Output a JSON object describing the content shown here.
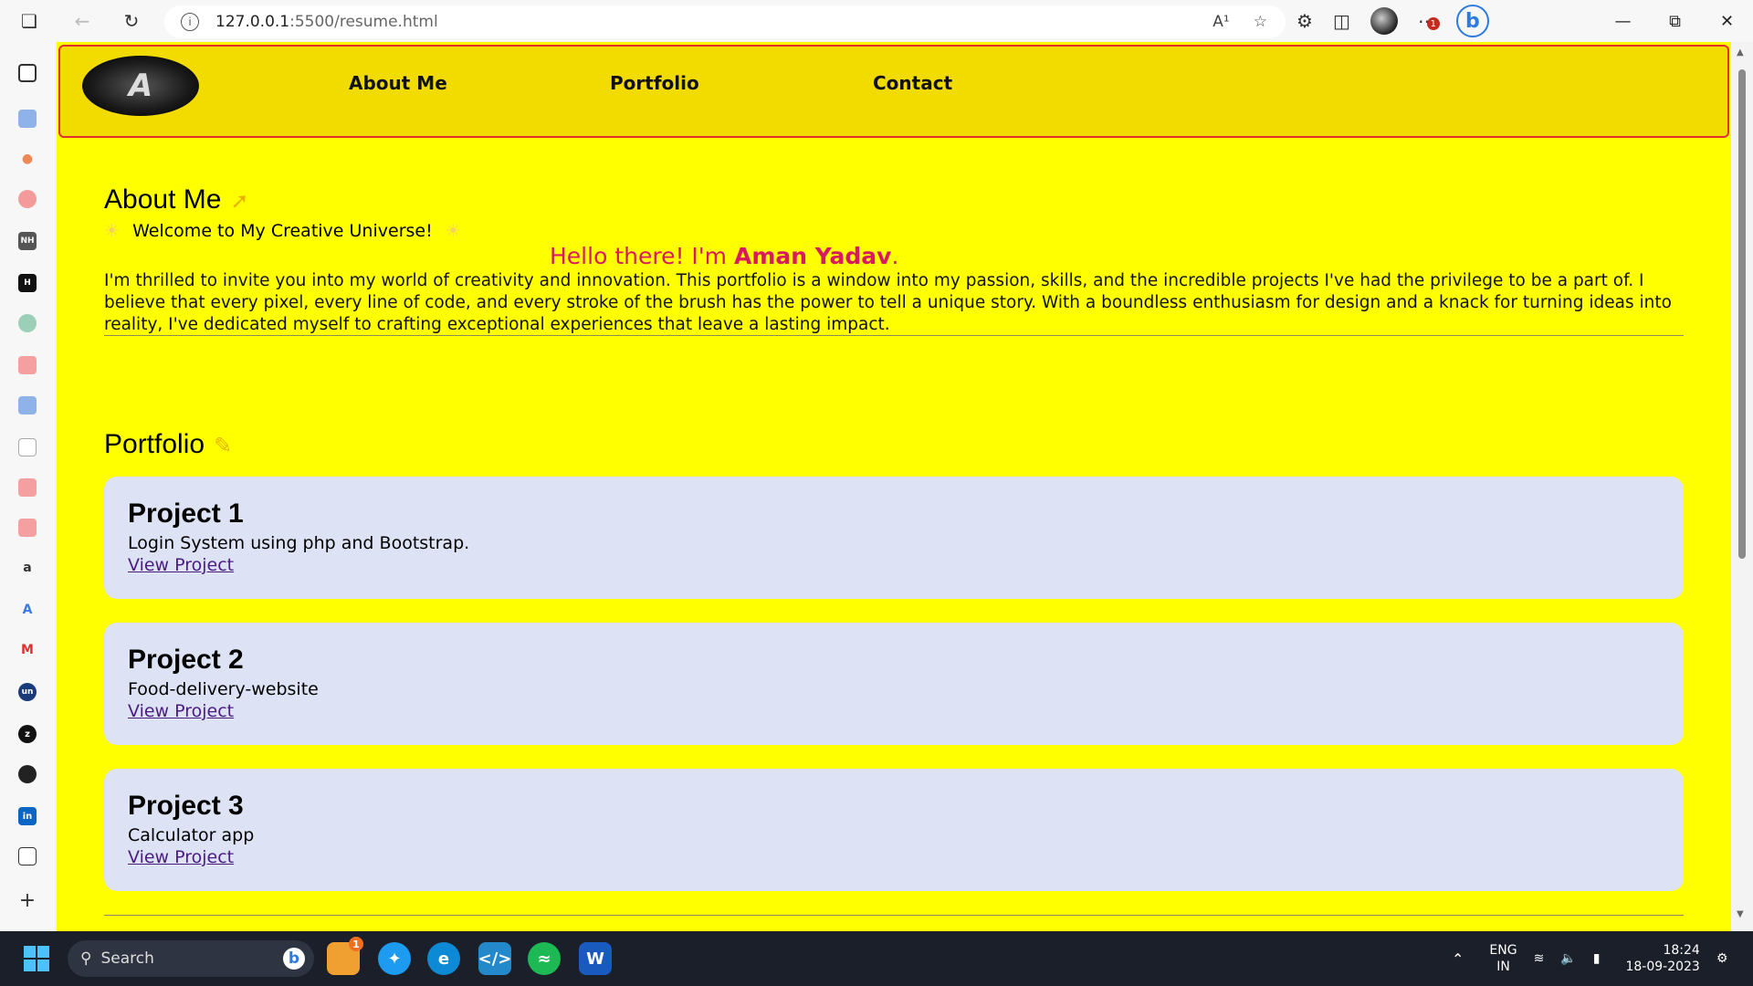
{
  "browser": {
    "url_host": "127.0.0.1",
    "url_path": ":5500/resume.html",
    "read_aloud": "A¹",
    "notif_count": "1"
  },
  "nav": {
    "logo_letter": "A",
    "links": [
      "About Me",
      "Portfolio",
      "Contact"
    ]
  },
  "about": {
    "title": "About Me",
    "welcome": "Welcome to My Creative Universe!",
    "hello_prefix": "Hello there! I'm ",
    "hello_name": "Aman Yadav",
    "hello_suffix": ".",
    "intro": "I'm thrilled to invite you into my world of creativity and innovation. This portfolio is a window into my passion, skills, and the incredible projects I've had the privilege to be a part of. I believe that every pixel, every line of code, and every stroke of the brush has the power to tell a unique story. With a boundless enthusiasm for design and a knack for turning ideas into reality, I've dedicated myself to crafting exceptional experiences that leave a lasting impact."
  },
  "portfolio": {
    "title": "Portfolio",
    "projects": [
      {
        "title": "Project 1",
        "desc": "Login System using php and Bootstrap.",
        "link": "View Project"
      },
      {
        "title": "Project 2",
        "desc": "Food-delivery-website",
        "link": "View Project"
      },
      {
        "title": "Project 3",
        "desc": "Calculator app",
        "link": "View Project"
      }
    ]
  },
  "taskbar": {
    "search_label": "Search",
    "badge_count": "1",
    "lang_line1": "ENG",
    "lang_line2": "IN",
    "time": "18:24",
    "date": "18-09-2023"
  },
  "colors": {
    "page_bg": "#ffff00",
    "navbar_bg": "#f2dc00",
    "navbar_border": "#e0312e",
    "hello_color": "#d81b60",
    "card_bg": "#dde3f5",
    "link_color": "#4b1c80"
  }
}
